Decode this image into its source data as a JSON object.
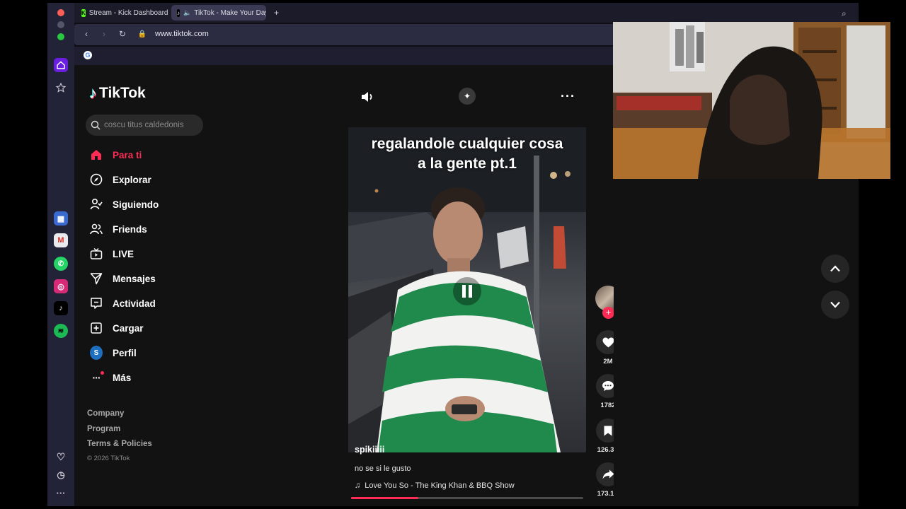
{
  "tabs": [
    {
      "label": "Stream - Kick Dashboard"
    },
    {
      "label": "TikTok - Make Your Day"
    }
  ],
  "browser": {
    "url": "www.tiktok.com"
  },
  "tiktok": {
    "brand": "TikTok",
    "search_value": "coscu titus caldedonis",
    "nav": [
      "Para ti",
      "Explorar",
      "Siguiendo",
      "Friends",
      "LIVE",
      "Mensajes",
      "Actividad",
      "Cargar",
      "Perfil",
      "Más"
    ],
    "profile_initial": "S",
    "footer": [
      "Company",
      "Program",
      "Terms & Policies",
      "© 2026 TikTok"
    ]
  },
  "video": {
    "overlay_text_line1": "regalandole cualquier cosa",
    "overlay_text_line2": "a la gente pt.1",
    "author": "spikiiiii",
    "description": "no se si le gusto",
    "music": "Love You So - The King Khan & BBQ Show",
    "progress_fraction": 0.29
  },
  "actions": {
    "likes": "2M",
    "comments": "1782",
    "saves": "126.3K",
    "shares": "173.1K"
  },
  "colors": {
    "accent": "#fe2c55",
    "background": "#121212"
  }
}
